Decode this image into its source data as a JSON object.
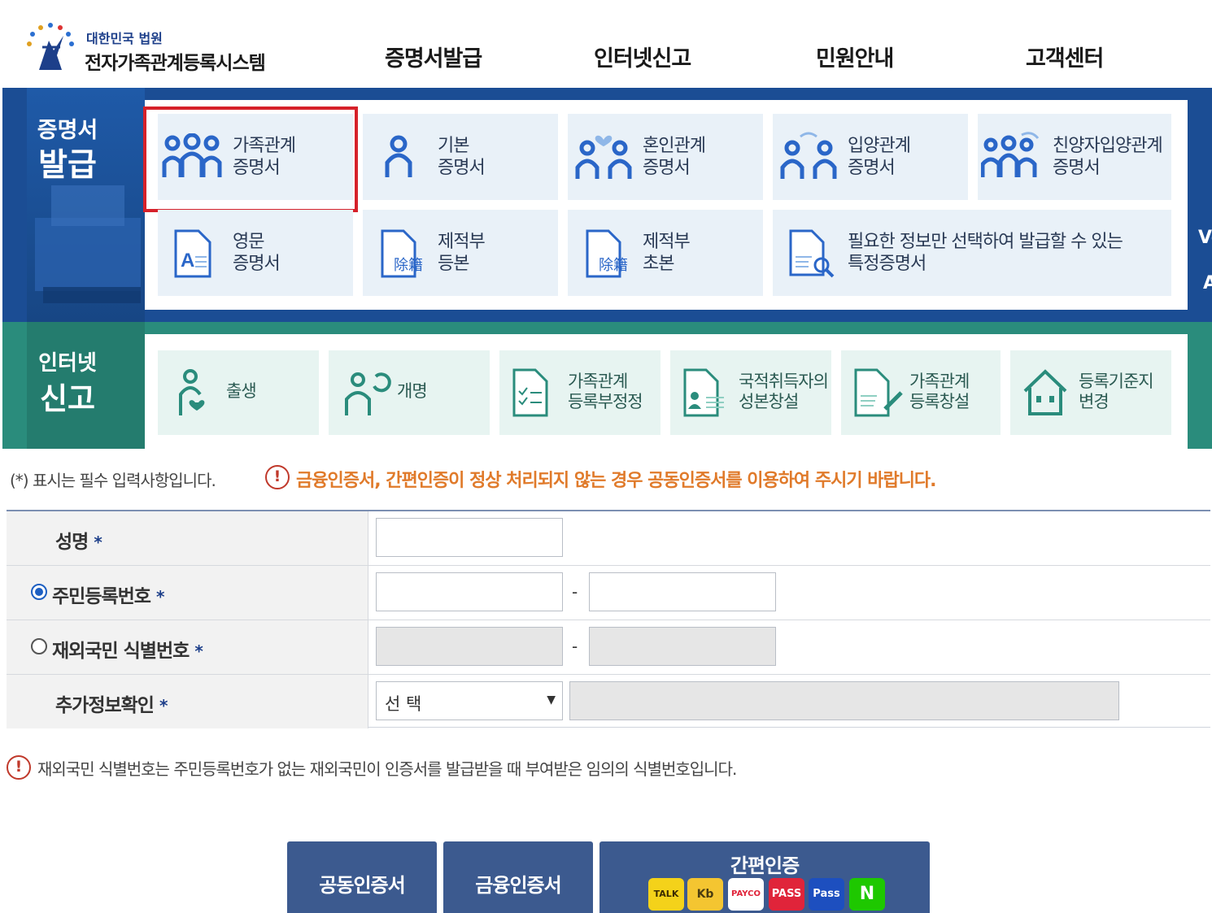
{
  "header": {
    "logo_small": "대한민국 법원",
    "logo_title": "전자가족관계등록시스템",
    "nav": [
      "증명서발급",
      "인터넷신고",
      "민원안내",
      "고객센터"
    ]
  },
  "issue_section": {
    "title_top": "증명서",
    "title_bottom": "발급",
    "tiles": [
      {
        "line1": "가족관계",
        "line2": "증명서",
        "icon": "family-icon"
      },
      {
        "line1": "기본",
        "line2": "증명서",
        "icon": "person-icon"
      },
      {
        "line1": "혼인관계",
        "line2": "증명서",
        "icon": "couple-heart-icon"
      },
      {
        "line1": "입양관계",
        "line2": "증명서",
        "icon": "adoption-icon"
      },
      {
        "line1": "친양자입양관계",
        "line2": "증명서",
        "icon": "family-arrow-icon"
      },
      {
        "line1": "영문",
        "line2": "증명서",
        "icon": "english-doc-icon"
      },
      {
        "line1": "제적부",
        "line2": "등본",
        "icon": "register-doc-icon",
        "badge": "除籍"
      },
      {
        "line1": "제적부",
        "line2": "초본",
        "icon": "register-doc-icon",
        "badge": "除籍"
      },
      {
        "line1": "필요한 정보만 선택하여 발급할 수 있는",
        "line2": "특정증명서",
        "icon": "doc-search-icon"
      }
    ],
    "edge_text": [
      "Ve",
      "A"
    ]
  },
  "report_section": {
    "title_top": "인터넷",
    "title_bottom": "신고",
    "tiles": [
      {
        "line1": "출생",
        "line2": "",
        "icon": "birth-icon"
      },
      {
        "line1": "개명",
        "line2": "",
        "icon": "rename-icon"
      },
      {
        "line1": "가족관계",
        "line2": "등록부정정",
        "icon": "checklist-doc-icon"
      },
      {
        "line1": "국적취득자의",
        "line2": "성본창설",
        "icon": "id-doc-icon"
      },
      {
        "line1": "가족관계",
        "line2": "등록창설",
        "icon": "pen-doc-icon"
      },
      {
        "line1": "등록기준지",
        "line2": "변경",
        "icon": "house-icon"
      }
    ]
  },
  "notice": {
    "required": "(*) 표시는 필수 입력사항입니다.",
    "warning_mark": "!",
    "warning": "금융인증서, 간편인증이 정상 처리되지 않는 경우 공동인증서를 이용하여 주시기 바랍니다."
  },
  "form": {
    "name_label": "성명",
    "rrn_label": "주민등록번호",
    "foreign_label": "재외국민 식별번호",
    "extra_label": "추가정보확인",
    "star": "*",
    "dash": "-",
    "select_value": "선 택",
    "select_arrow": "▼"
  },
  "foot_note": "재외국민 식별번호는 주민등록번호가 없는 재외국민이 인증서를 발급받을 때 부여받은 임의의 식별번호입니다.",
  "buttons": {
    "joint_cert": "공동인증서",
    "finance_cert": "금융인증서",
    "simple_auth": "간편인증",
    "auth_icons": [
      "TALK",
      "Kb",
      "PAYCO",
      "PASS",
      "Pass",
      "N"
    ]
  },
  "colors": {
    "issue_band": "#1b4d94",
    "report_band": "#2a8c7c",
    "highlight": "#d6212a",
    "warning": "#e07a2a",
    "button": "#3c5a8f"
  }
}
